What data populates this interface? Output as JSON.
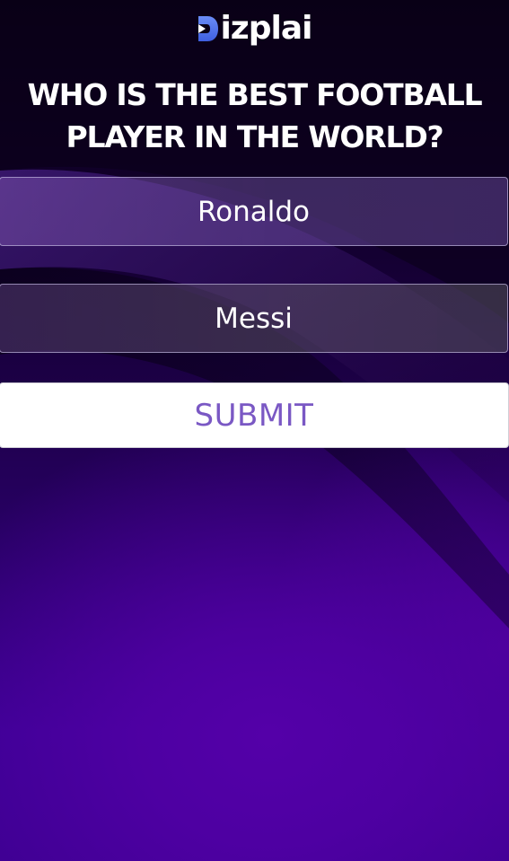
{
  "brand": {
    "logo_text": "izplai",
    "logo_accent_color": "#4f7cf0"
  },
  "poll": {
    "question": "WHO IS THE BEST FOOTBALL PLAYER IN THE WORLD?",
    "options": [
      {
        "label": "Ronaldo"
      },
      {
        "label": "Messi"
      }
    ],
    "submit_label": "SUBMIT"
  },
  "colors": {
    "background_top": "#0b0018",
    "background_bottom": "#5400a8",
    "submit_text": "#7a58c4"
  }
}
